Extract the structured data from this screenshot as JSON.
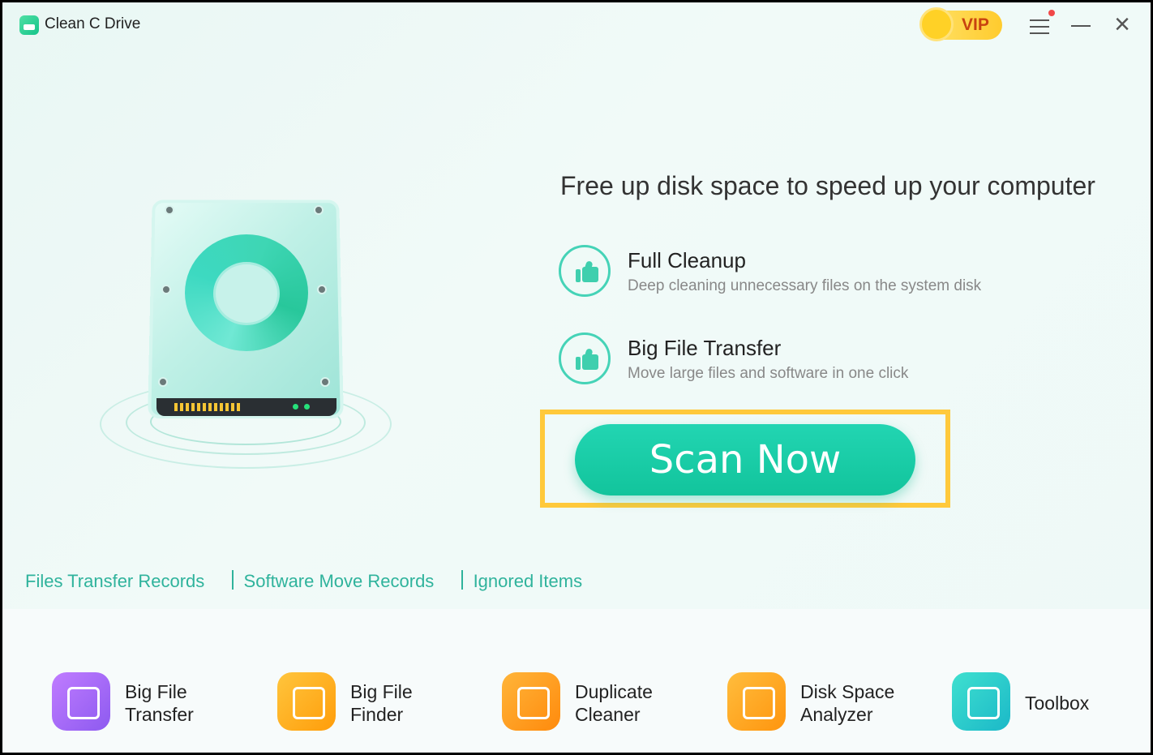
{
  "app": {
    "title": "Clean C Drive"
  },
  "header": {
    "vip_label": "VIP"
  },
  "hero": {
    "headline": "Free up disk space to speed up your computer",
    "features": [
      {
        "title": "Full Cleanup",
        "description": "Deep cleaning unnecessary files on the system disk"
      },
      {
        "title": "Big File Transfer",
        "description": "Move large files and software in one click"
      }
    ],
    "scan_button": "Scan Now"
  },
  "links": {
    "files_transfer": "Files Transfer Records",
    "software_move": "Software Move Records",
    "ignored": "Ignored Items"
  },
  "tools": [
    {
      "line1": "Big File",
      "line2": "Transfer",
      "color": "#a56cf0"
    },
    {
      "line1": "Big File",
      "line2": "Finder",
      "color": "#ffae1c"
    },
    {
      "line1": "Duplicate",
      "line2": "Cleaner",
      "color": "#ff9f1a"
    },
    {
      "line1": "Disk Space",
      "line2": "Analyzer",
      "color": "#ffa51c"
    },
    {
      "line1": "Toolbox",
      "line2": "",
      "color": "#2fcfc3"
    }
  ],
  "colors": {
    "accent": "#16c9a3",
    "highlight_frame": "#ffc93b",
    "link": "#2fb39c"
  }
}
